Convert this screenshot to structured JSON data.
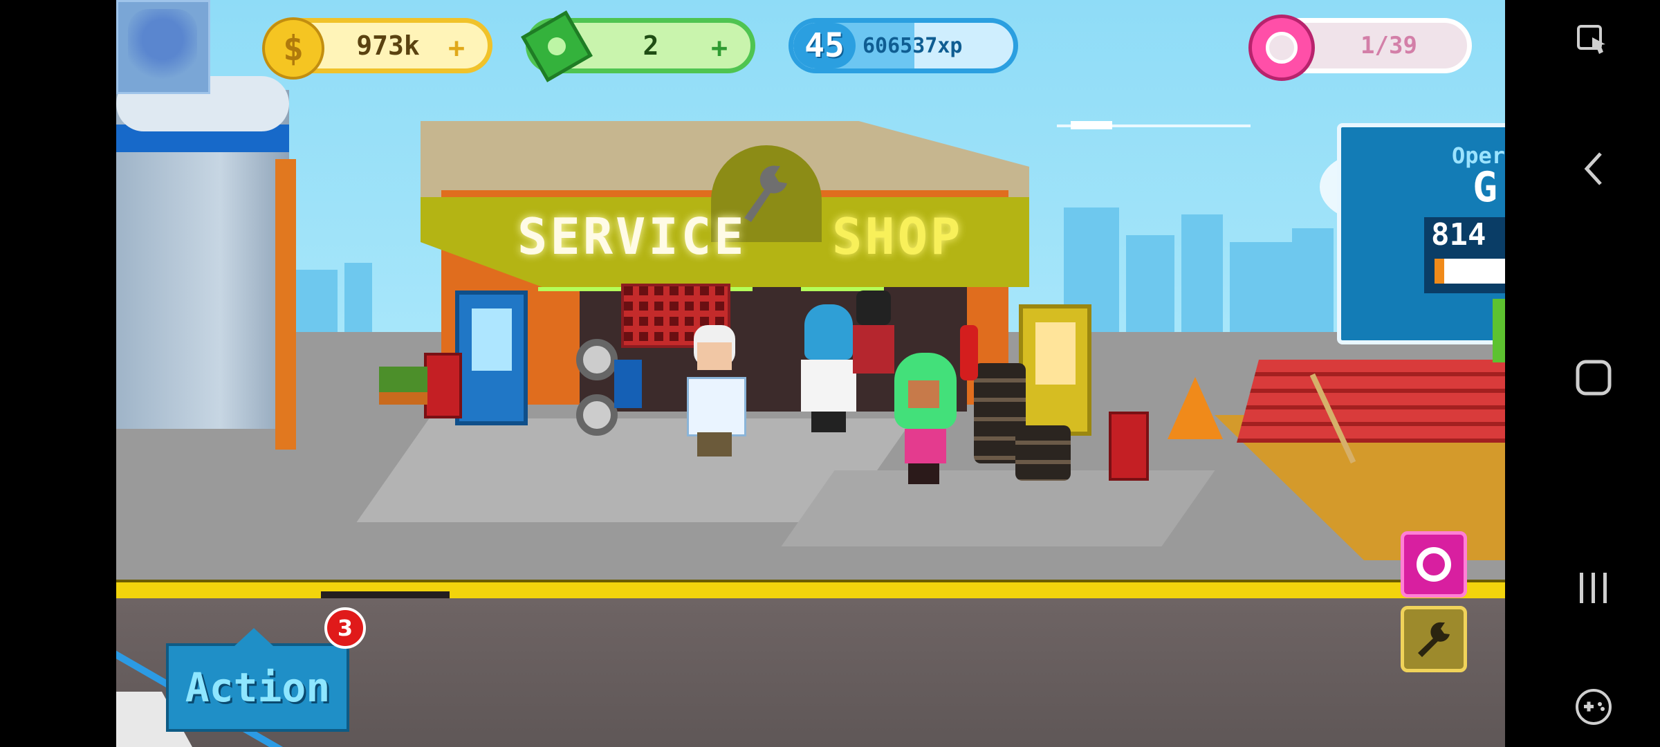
{
  "hud": {
    "coins": "973k",
    "cash": "2",
    "level": "45",
    "xp": "606537xp",
    "xp_progress": 0.55,
    "donuts": "1/39"
  },
  "shop": {
    "sign_word1": "SERVICE",
    "sign_word2": "SHOP"
  },
  "panel": {
    "line1": "Oper",
    "line2": "G",
    "line3": "814"
  },
  "action": {
    "label": "Action",
    "badge": "3"
  },
  "icons": {
    "camera": "donut-camera-icon",
    "wrench": "wrench-icon",
    "nav_back": "back-icon",
    "nav_home": "home-icon",
    "nav_recents": "recents-icon",
    "game_tools": "gamepad-icon",
    "touch_lock": "touch-lock-icon"
  },
  "colors": {
    "sky": "#a7e6fa",
    "coin": "#f5c522",
    "cash": "#4fc451",
    "xp": "#2b9fe0",
    "donut": "#ff4fa8",
    "action": "#1f8fc7"
  }
}
